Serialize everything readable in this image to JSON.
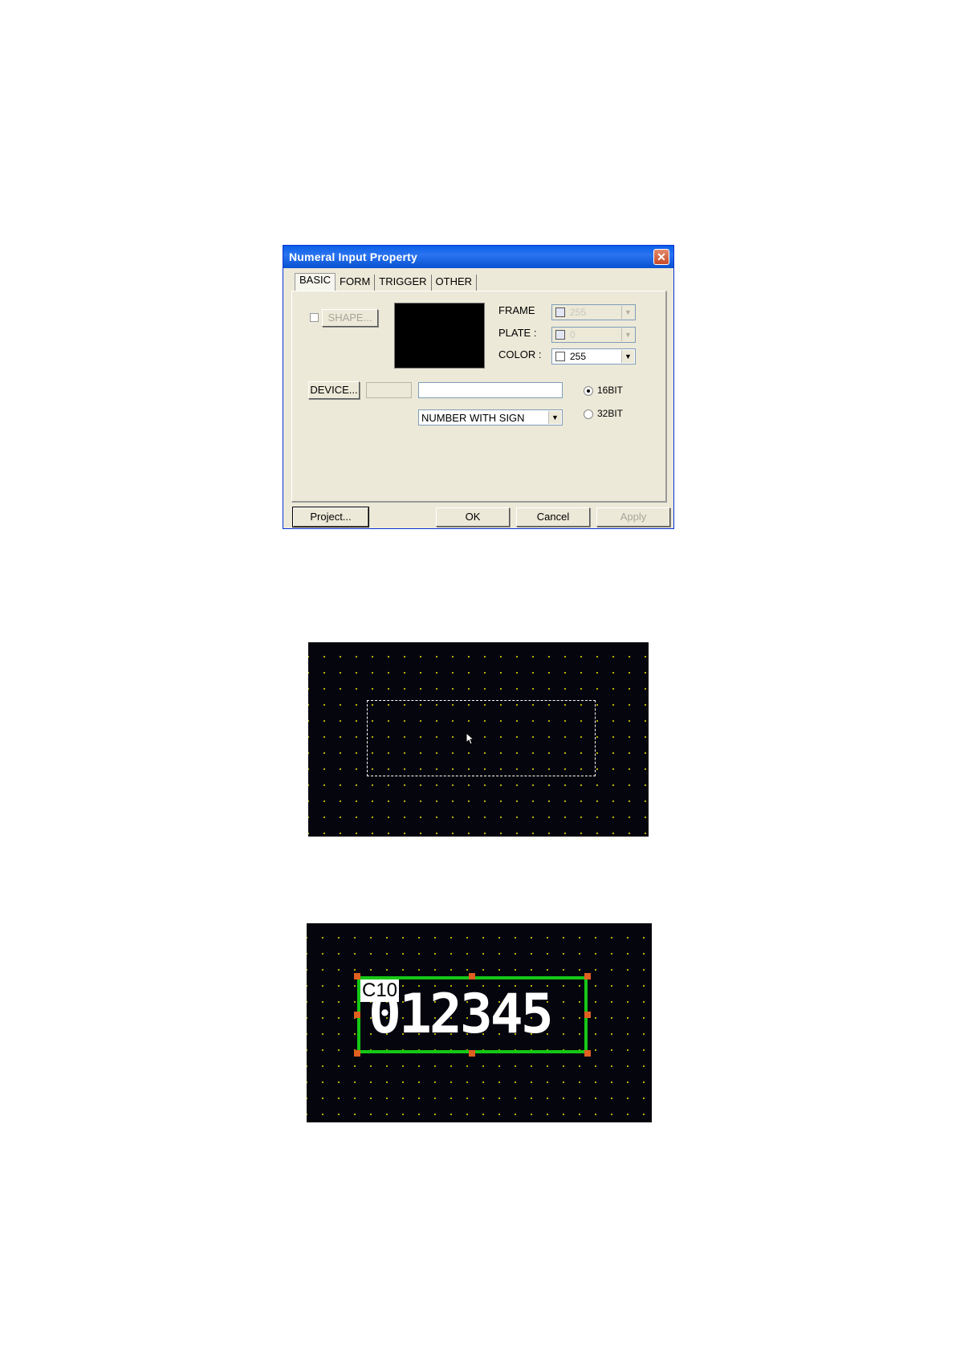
{
  "dialog": {
    "title": "Numeral Input Property",
    "close": "✕",
    "tabs": [
      "BASIC",
      "FORM",
      "TRIGGER",
      "OTHER"
    ],
    "active_tab": "BASIC",
    "shape_button": "SHAPE...",
    "frame_label": "FRAME",
    "plate_label": "PLATE :",
    "color_label": "COLOR :",
    "frame_value": "255",
    "plate_value": "0",
    "color_value": "255",
    "device_button": "DEVICE...",
    "device_input": "",
    "device_name_input": "",
    "format_select": "NUMBER WITH SIGN",
    "bit16_label": "16BIT",
    "bit32_label": "32BIT",
    "bit_selected": "16BIT",
    "project_button": "Project...",
    "ok_button": "OK",
    "cancel_button": "Cancel",
    "apply_button": "Apply"
  },
  "result_screen": {
    "device_label": "C10",
    "display_value": "012345"
  },
  "colors": {
    "dialog_bg": "#ece9d8",
    "titlebar": "#0a5fe8",
    "screen_bg": "#05050d",
    "grid_dot": "#c8c000",
    "selection_frame": "#16c816",
    "handle": "#e06020"
  }
}
